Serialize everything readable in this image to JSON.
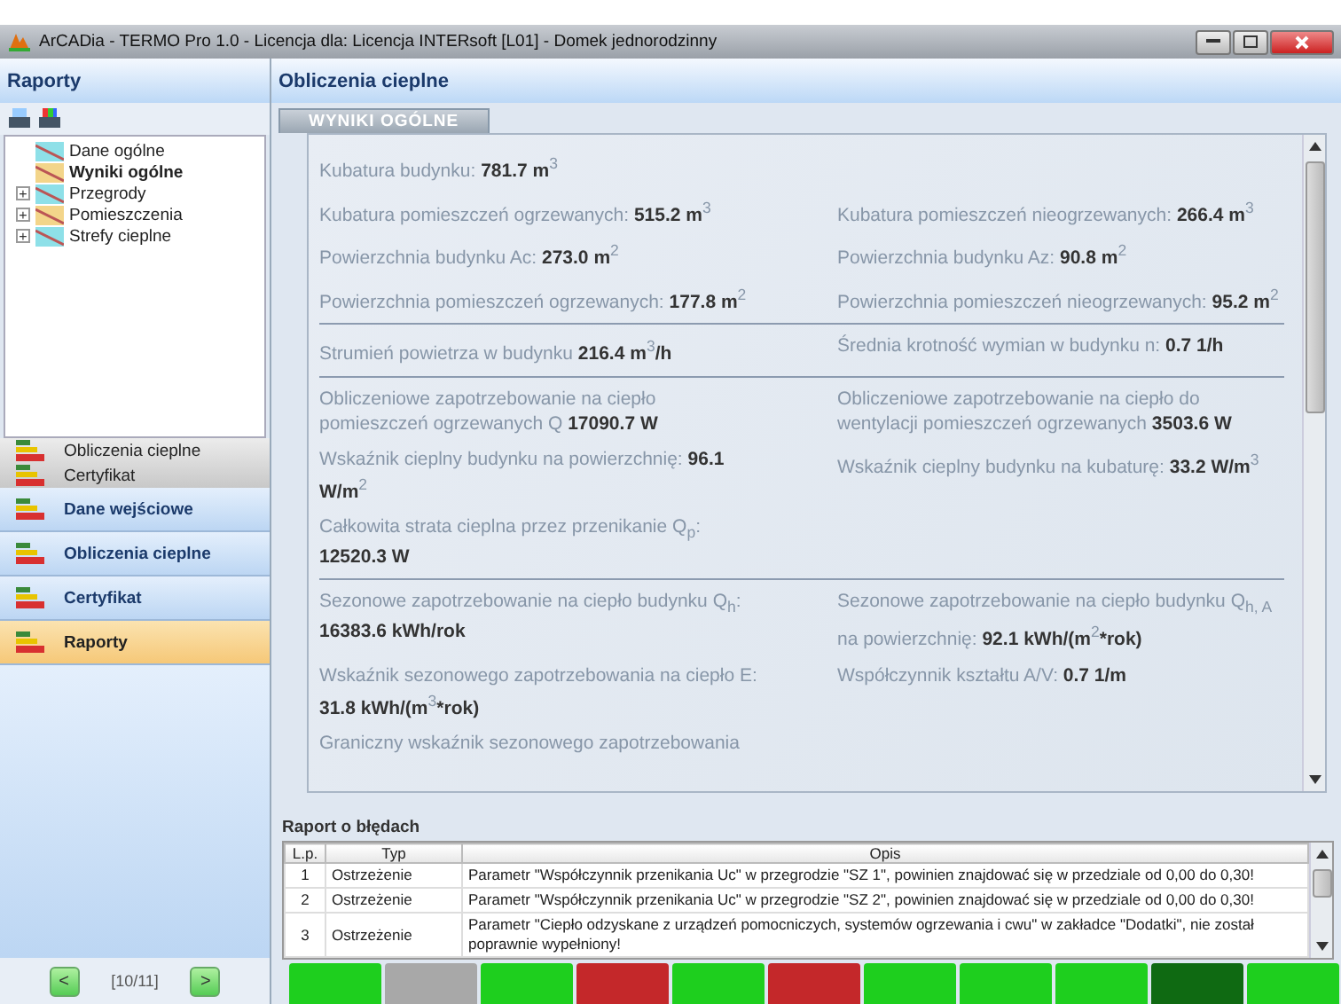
{
  "window": {
    "title": "ArCADia - TERMO Pro 1.0 - Licencja dla: Licencja INTERsoft [L01] - Domek jednorodzinny"
  },
  "sidebar": {
    "title": "Raporty",
    "tree": [
      {
        "label": "Dane ogólne",
        "selected": false
      },
      {
        "label": "Wyniki ogólne",
        "selected": true
      },
      {
        "label": "Przegrody",
        "selected": false,
        "expander": "+"
      },
      {
        "label": "Pomieszczenia",
        "selected": false,
        "expander": "+"
      },
      {
        "label": "Strefy cieplne",
        "selected": false,
        "expander": "+"
      }
    ],
    "stack_items": [
      "Obliczenia cieplne",
      "Certyfikat"
    ],
    "nav": [
      {
        "label": "Dane wejściowe",
        "selected": false
      },
      {
        "label": "Obliczenia cieplne",
        "selected": false
      },
      {
        "label": "Certyfikat",
        "selected": false
      },
      {
        "label": "Raporty",
        "selected": true
      }
    ],
    "pager": {
      "prev": "<",
      "page": "[10/11]",
      "next": ">"
    }
  },
  "main": {
    "title": "Obliczenia cieplne",
    "tab": "WYNIKI OGÓLNE",
    "groups": [
      [
        [
          "Kubatura budynku: **781.7 m**$^{3}$"
        ],
        [
          "Kubatura pomieszczeń ogrzewanych: **515.2 m**$^{3}$",
          "Kubatura pomieszczeń nieogrzewanych: **266.4 m**$^{3}$"
        ],
        [
          "Powierzchnia budynku Ac: **273.0 m**$^{2}$",
          "Powierzchnia budynku Az: **90.8 m**$^{2}$"
        ],
        [
          "Powierzchnia pomieszczeń ogrzewanych: **177.8 m**$^{2}$",
          "Powierzchnia pomieszczeń nieogrzewanych: **95.2 m**$^{2}$"
        ]
      ],
      [
        [
          "Strumień powietrza w budynku **216.4 m**$^{3}$**/h**",
          "Średnia krotność wymian w budynku n: **0.7 1/h**"
        ]
      ],
      [
        [
          "Obliczeniowe zapotrzebowanie na ciepło pomieszczeń ogrzewanych Q **17090.7 W**",
          "Obliczeniowe zapotrzebowanie na ciepło do wentylacji pomieszczeń ogrzewanych **3503.6 W**"
        ],
        [
          "Wskaźnik cieplny budynku na powierzchnię: **96.1 W/m**$^{2}$",
          "Wskaźnik cieplny budynku na kubaturę: **33.2 W/m**$^{3}$"
        ],
        [
          "Całkowita strata cieplna przez przenikanie Q$_{p}$: **12520.3 W**"
        ]
      ],
      [
        [
          "Sezonowe zapotrzebowanie na ciepło budynku Q$_{h}$: **16383.6 kWh/rok**",
          "Sezonowe zapotrzebowanie na ciepło budynku Q$_{h, A}$ na powierzchnię: **92.1 kWh/(m**$^{2}$***rok)**"
        ],
        [
          "Wskaźnik sezonowego zapotrzebowania na ciepło E: **31.8 kWh/(m**$^{3}$***rok)**",
          "Współczynnik kształtu A/V: **0.7 1/m**"
        ],
        [
          "Graniczny wskaźnik sezonowego zapotrzebowania"
        ]
      ]
    ]
  },
  "errors": {
    "title": "Raport o błędach",
    "columns": [
      "L.p.",
      "Typ",
      "Opis"
    ],
    "rows": [
      [
        "1",
        "Ostrzeżenie",
        "Parametr \"Współczynnik przenikania Uc\" w przegrodzie \"SZ 1\", powinien znajdować się w przedziale od 0,00 do 0,30!"
      ],
      [
        "2",
        "Ostrzeżenie",
        "Parametr \"Współczynnik przenikania Uc\" w przegrodzie \"SZ 2\", powinien znajdować się w przedziale od 0,00 do 0,30!"
      ],
      [
        "3",
        "Ostrzeżenie",
        "Parametr \"Ciepło odzyskane z urządzeń pomocniczych, systemów ogrzewania i cwu\" w zakładce \"Dodatki\", nie został poprawnie wypełniony!"
      ]
    ]
  },
  "status_blocks": [
    {
      "color": "#1ecf1e"
    },
    {
      "color": "#a8a8a8"
    },
    {
      "color": "#1ecf1e"
    },
    {
      "color": "#c4282a"
    },
    {
      "color": "#1ecf1e"
    },
    {
      "color": "#c4282a"
    },
    {
      "color": "#1ecf1e"
    },
    {
      "color": "#1ecf1e"
    },
    {
      "color": "#1ecf1e"
    },
    {
      "color": "#0f6a12"
    },
    {
      "color": "#1ecf1e"
    }
  ]
}
